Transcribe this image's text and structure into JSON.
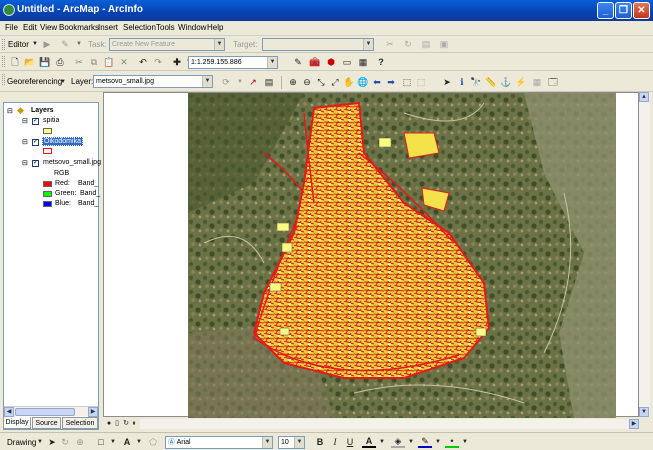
{
  "window": {
    "title": "Untitled - ArcMap - ArcInfo",
    "minimize_glyph": "_",
    "maximize_glyph": "❐",
    "close_glyph": "✕"
  },
  "menu": {
    "items": [
      "File",
      "Edit",
      "View",
      "Bookmarks",
      "Insert",
      "Selection",
      "Tools",
      "Window",
      "Help"
    ]
  },
  "editor": {
    "label": "Editor",
    "task_label": "Task:",
    "task_value": "Create New Feature",
    "target_label": "Target:",
    "target_value": ""
  },
  "standard": {
    "scale_value": "1:1.259.155.886"
  },
  "georef": {
    "label": "Georeferencing",
    "layer_label": "Layer:",
    "layer_value": "metsovo_small.jpg"
  },
  "toc": {
    "root_label": "Layers",
    "layers": [
      {
        "name": "spitia",
        "checked": true
      },
      {
        "name": "Oikodomika",
        "checked": true,
        "selected": true
      },
      {
        "name": "metsovo_small.jpg",
        "checked": true
      }
    ],
    "raster_legend": {
      "rgb_label": "RGB",
      "bands": [
        {
          "label": "Red:",
          "value": "Band_",
          "color": "#ff0000"
        },
        {
          "label": "Green:",
          "value": "Band_",
          "color": "#00ff00"
        },
        {
          "label": "Blue:",
          "value": "Band_",
          "color": "#0000ff"
        }
      ]
    },
    "tabs": [
      "Display",
      "Source",
      "Selection"
    ]
  },
  "drawing": {
    "label": "Drawing",
    "font_name": "Arial",
    "font_size": "10",
    "bold": "B",
    "italic": "I",
    "underline": "U",
    "font_color_glyph": "A"
  },
  "colors": {
    "spitia_fill": "#fffb80",
    "oikodomika_fill": "#ffffff",
    "parcel_outline": "#e11a1a",
    "building_fill": "#f3e24a"
  }
}
